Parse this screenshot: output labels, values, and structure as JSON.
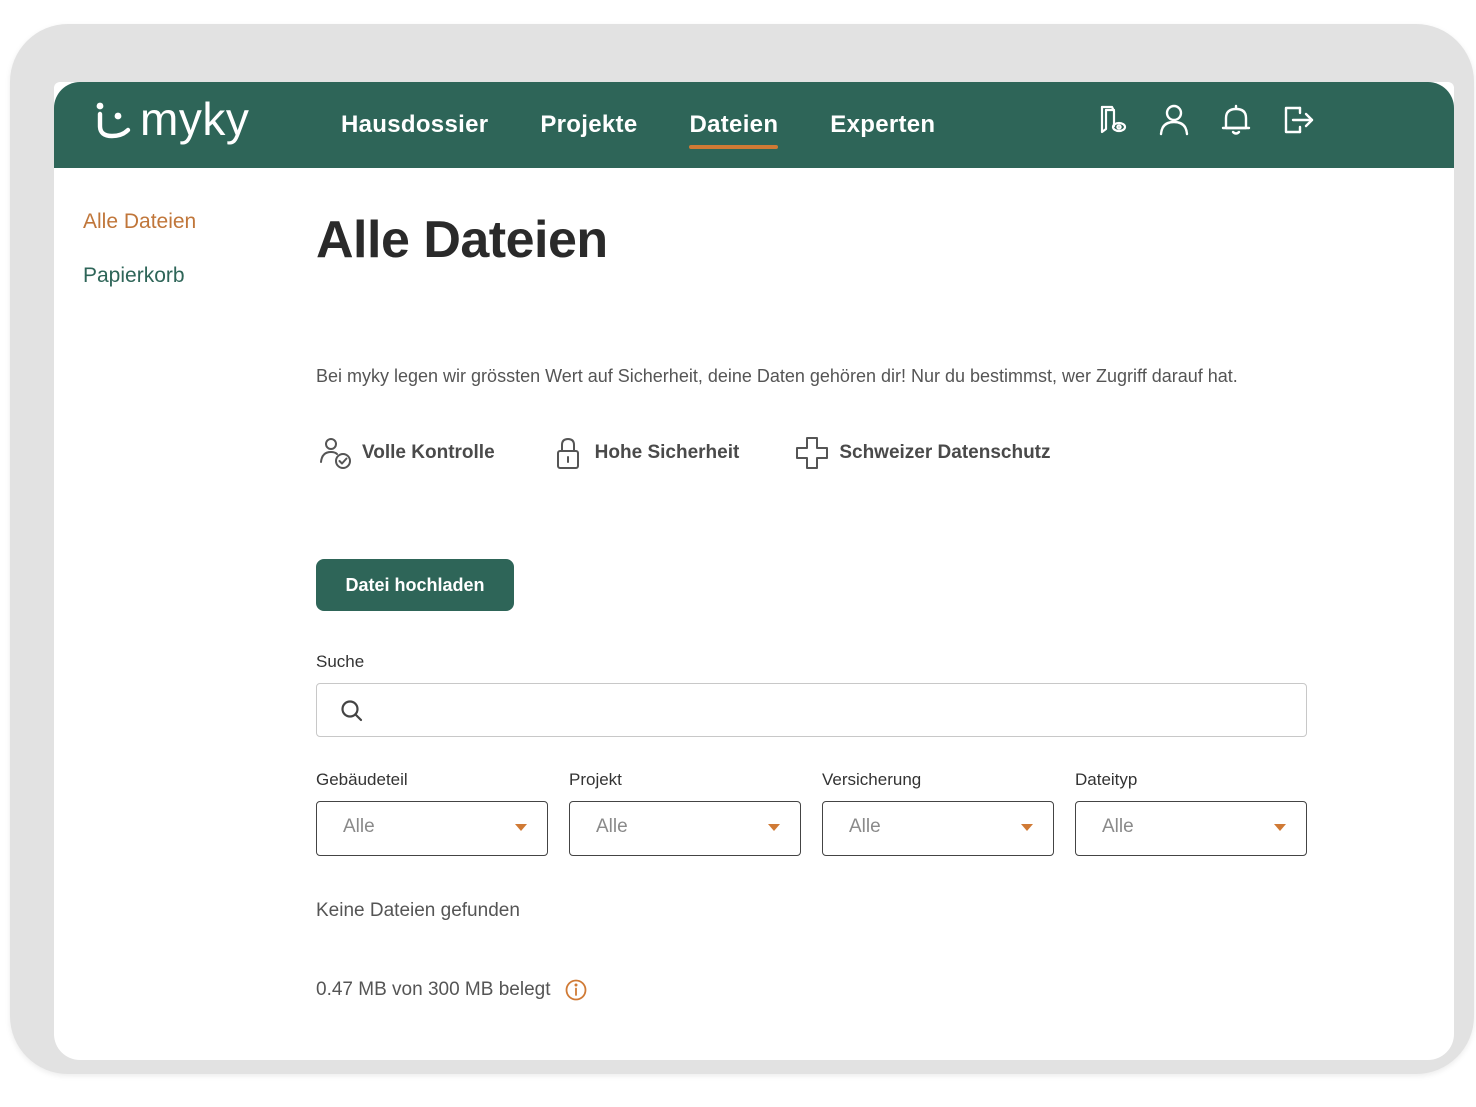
{
  "brand": {
    "name": "myky"
  },
  "nav": {
    "links": [
      {
        "label": "Hausdossier"
      },
      {
        "label": "Projekte"
      },
      {
        "label": "Dateien"
      },
      {
        "label": "Experten"
      }
    ],
    "active_link": "Dateien",
    "icons": [
      "document-eye-icon",
      "user-icon",
      "bell-icon",
      "logout-icon"
    ]
  },
  "sidebar": {
    "items": [
      {
        "label": "Alle Dateien",
        "active": true
      },
      {
        "label": "Papierkorb",
        "active": false
      }
    ]
  },
  "main": {
    "title": "Alle Dateien",
    "intro": "Bei myky legen wir grössten Wert auf Sicherheit, deine Daten gehören dir! Nur du bestimmst, wer Zugriff darauf hat.",
    "features": [
      {
        "icon": "person-check-icon",
        "label": "Volle Kontrolle"
      },
      {
        "icon": "lock-icon",
        "label": "Hohe Sicherheit"
      },
      {
        "icon": "swiss-cross-icon",
        "label": "Schweizer Datenschutz"
      }
    ],
    "upload_button": "Datei hochladen",
    "search": {
      "label": "Suche",
      "value": "",
      "placeholder": ""
    },
    "filters": [
      {
        "label": "Gebäudeteil",
        "value": "Alle"
      },
      {
        "label": "Projekt",
        "value": "Alle"
      },
      {
        "label": "Versicherung",
        "value": "Alle"
      },
      {
        "label": "Dateityp",
        "value": "Alle"
      }
    ],
    "empty_message": "Keine Dateien gefunden",
    "storage": "0.47 MB von 300 MB belegt"
  },
  "colors": {
    "brand_green": "#2e6558",
    "accent_orange": "#d07a35",
    "active_sidebar": "#c0763a"
  }
}
